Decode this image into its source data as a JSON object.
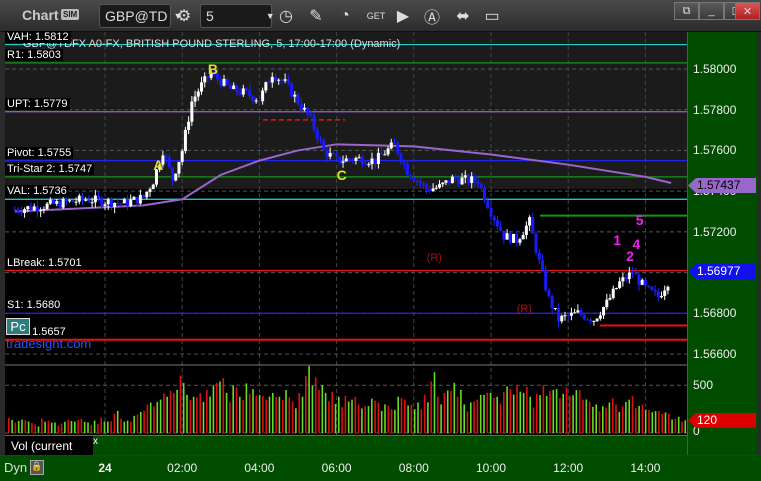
{
  "window": {
    "title": "Chart",
    "sim_badge": "SIM",
    "symbol": "GBP@TD",
    "interval": "5",
    "toolbar_icons": [
      "settings-icon",
      "clock-icon",
      "pencil-icon",
      "gauge-icon",
      "get-icon",
      "play-icon",
      "alert-icon",
      "link-icon",
      "comment-icon"
    ],
    "window_buttons": [
      "popout-icon",
      "minimize-icon",
      "maximize-icon",
      "close-icon"
    ]
  },
  "chart_header": "GBP@TDFX A0-FX, BRITISH POUND STERLING, 5, 17:00-17:00 (Dynamic)",
  "watermark": "tradesight.com",
  "pc_button": "Pc",
  "colors": {
    "up": "#ffffff",
    "down": "#1a1aff",
    "ma": "#9966cc",
    "vol_up": "#66dd22",
    "vol_down": "#dd1111",
    "axis_bg": "#004d00"
  },
  "levels": [
    {
      "label": "VAH: 1.5812",
      "price": 1.5812,
      "color": "#22cccc"
    },
    {
      "label": "R1: 1.5803",
      "price": 1.5803,
      "color": "#119911"
    },
    {
      "label": "UPT: 1.5779",
      "price": 1.5779,
      "color": "#9966cc"
    },
    {
      "label": "Pivot: 1.5755",
      "price": 1.5755,
      "color": "#2222ee"
    },
    {
      "label": "Tri-Star 2: 1.5747",
      "price": 1.5747,
      "color": "#119911"
    },
    {
      "label": "VAL: 1.5736",
      "price": 1.5736,
      "color": "#22dddd"
    },
    {
      "label": "LBreak: 1.5701",
      "price": 1.5701,
      "color": "#ee1111"
    },
    {
      "label": "S1: 1.5680",
      "price": 1.568,
      "color": "#2222ee"
    },
    {
      "label": "LPT: 1.5657",
      "price": 1.5667,
      "color": "#ee1111"
    }
  ],
  "chart_data": {
    "type": "candlestick",
    "title": "GBP@TDFX A0-FX, BRITISH POUND STERLING, 5, 17:00-17:00 (Dynamic)",
    "price_ticks": [
      "1.58000",
      "1.57800",
      "1.57600",
      "1.57400",
      "1.57200",
      "1.57000",
      "1.56800",
      "1.56600"
    ],
    "ylim": [
      1.5654,
      1.5812
    ],
    "time_ticks": [
      "24",
      "02:00",
      "04:00",
      "06:00",
      "08:00",
      "10:00",
      "12:00",
      "14:00"
    ],
    "price_path": [
      [
        "21:40",
        1.5731
      ],
      [
        "22:30",
        1.5733
      ],
      [
        "23:30",
        1.5736
      ],
      [
        "00:30",
        1.5734
      ],
      [
        "01:00",
        1.5737
      ],
      [
        "01:15",
        1.5745
      ],
      [
        "01:30",
        1.576
      ],
      [
        "01:45",
        1.5746
      ],
      [
        "02:00",
        1.576
      ],
      [
        "02:15",
        1.5784
      ],
      [
        "02:30",
        1.5792
      ],
      [
        "02:45",
        1.5798
      ],
      [
        "03:15",
        1.579
      ],
      [
        "03:40",
        1.5788
      ],
      [
        "04:00",
        1.5785
      ],
      [
        "04:20",
        1.5798
      ],
      [
        "04:40",
        1.5793
      ],
      [
        "05:00",
        1.5784
      ],
      [
        "05:20",
        1.5775
      ],
      [
        "05:40",
        1.576
      ],
      [
        "06:00",
        1.5755
      ],
      [
        "06:30",
        1.5756
      ],
      [
        "07:00",
        1.5755
      ],
      [
        "07:30",
        1.5763
      ],
      [
        "07:50",
        1.575
      ],
      [
        "08:20",
        1.5741
      ],
      [
        "08:40",
        1.5742
      ],
      [
        "09:00",
        1.5746
      ],
      [
        "09:40",
        1.5745
      ],
      [
        "10:00",
        1.573
      ],
      [
        "10:20",
        1.5718
      ],
      [
        "10:40",
        1.5716
      ],
      [
        "11:00",
        1.5725
      ],
      [
        "11:15",
        1.5705
      ],
      [
        "11:30",
        1.5687
      ],
      [
        "11:45",
        1.5677
      ],
      [
        "12:15",
        1.568
      ],
      [
        "12:40",
        1.5677
      ],
      [
        "13:00",
        1.5685
      ],
      [
        "13:20",
        1.5695
      ],
      [
        "13:40",
        1.57
      ],
      [
        "14:00",
        1.5692
      ],
      [
        "14:20",
        1.5688
      ],
      [
        "14:40",
        1.5698
      ]
    ],
    "moving_average": [
      [
        "21:40",
        1.573
      ],
      [
        "01:00",
        1.5733
      ],
      [
        "02:00",
        1.5736
      ],
      [
        "03:00",
        1.5748
      ],
      [
        "04:00",
        1.5755
      ],
      [
        "05:00",
        1.576
      ],
      [
        "06:00",
        1.5763
      ],
      [
        "08:00",
        1.5762
      ],
      [
        "10:00",
        1.5758
      ],
      [
        "12:00",
        1.5753
      ],
      [
        "14:00",
        1.5747
      ],
      [
        "14:40",
        1.5744
      ]
    ],
    "last_price": "1.56977",
    "ma_value": "1.57437",
    "annotations": [
      {
        "text": "A",
        "time": "01:15",
        "price": 1.5753,
        "color": "#dddd22"
      },
      {
        "text": "B",
        "time": "02:40",
        "price": 1.58,
        "color": "#dddd22"
      },
      {
        "text": "C",
        "time": "06:00",
        "price": 1.5748,
        "color": "#dddd22"
      },
      {
        "text": "(R)",
        "time": "08:20",
        "price": 1.5706,
        "color": "#aa1111"
      },
      {
        "text": "(R)",
        "time": "10:40",
        "price": 1.5681,
        "color": "#aa1111"
      },
      {
        "text": "1",
        "time": "13:10",
        "price": 1.5716,
        "color": "#ee22ee"
      },
      {
        "text": "2",
        "time": "13:30",
        "price": 1.5708,
        "color": "#ee22ee"
      },
      {
        "text": "4",
        "time": "13:40",
        "price": 1.5714,
        "color": "#ee22ee"
      },
      {
        "text": "5",
        "time": "13:45",
        "price": 1.5726,
        "color": "#ee22ee"
      }
    ],
    "volume": {
      "label": "Vol (current price bar)",
      "ticks": [
        "500",
        "0"
      ],
      "last": "120",
      "ymax": 650,
      "values": [
        160,
        110,
        140,
        120,
        90,
        150,
        130,
        110,
        100,
        140,
        120,
        150,
        110,
        130,
        160,
        120,
        200,
        150,
        130,
        180,
        220,
        300,
        280,
        350,
        380,
        420,
        600,
        400,
        380,
        420,
        450,
        500,
        540,
        420,
        500,
        380,
        520,
        460,
        400,
        350,
        420,
        380,
        450,
        330,
        420,
        600,
        500,
        450,
        420,
        430,
        380,
        390,
        350,
        300,
        280,
        360,
        320,
        300,
        250,
        380,
        350,
        300,
        320,
        400,
        540,
        380,
        420,
        440,
        380,
        300,
        320,
        350,
        400,
        420,
        380,
        430,
        460,
        500,
        420,
        380,
        410,
        500,
        440,
        460,
        410,
        390,
        450,
        350,
        330,
        300,
        280,
        320,
        300,
        280,
        350,
        260,
        300,
        240,
        230,
        200,
        200,
        150,
        120
      ]
    }
  },
  "time_axis": {
    "mode": "Dyn"
  }
}
